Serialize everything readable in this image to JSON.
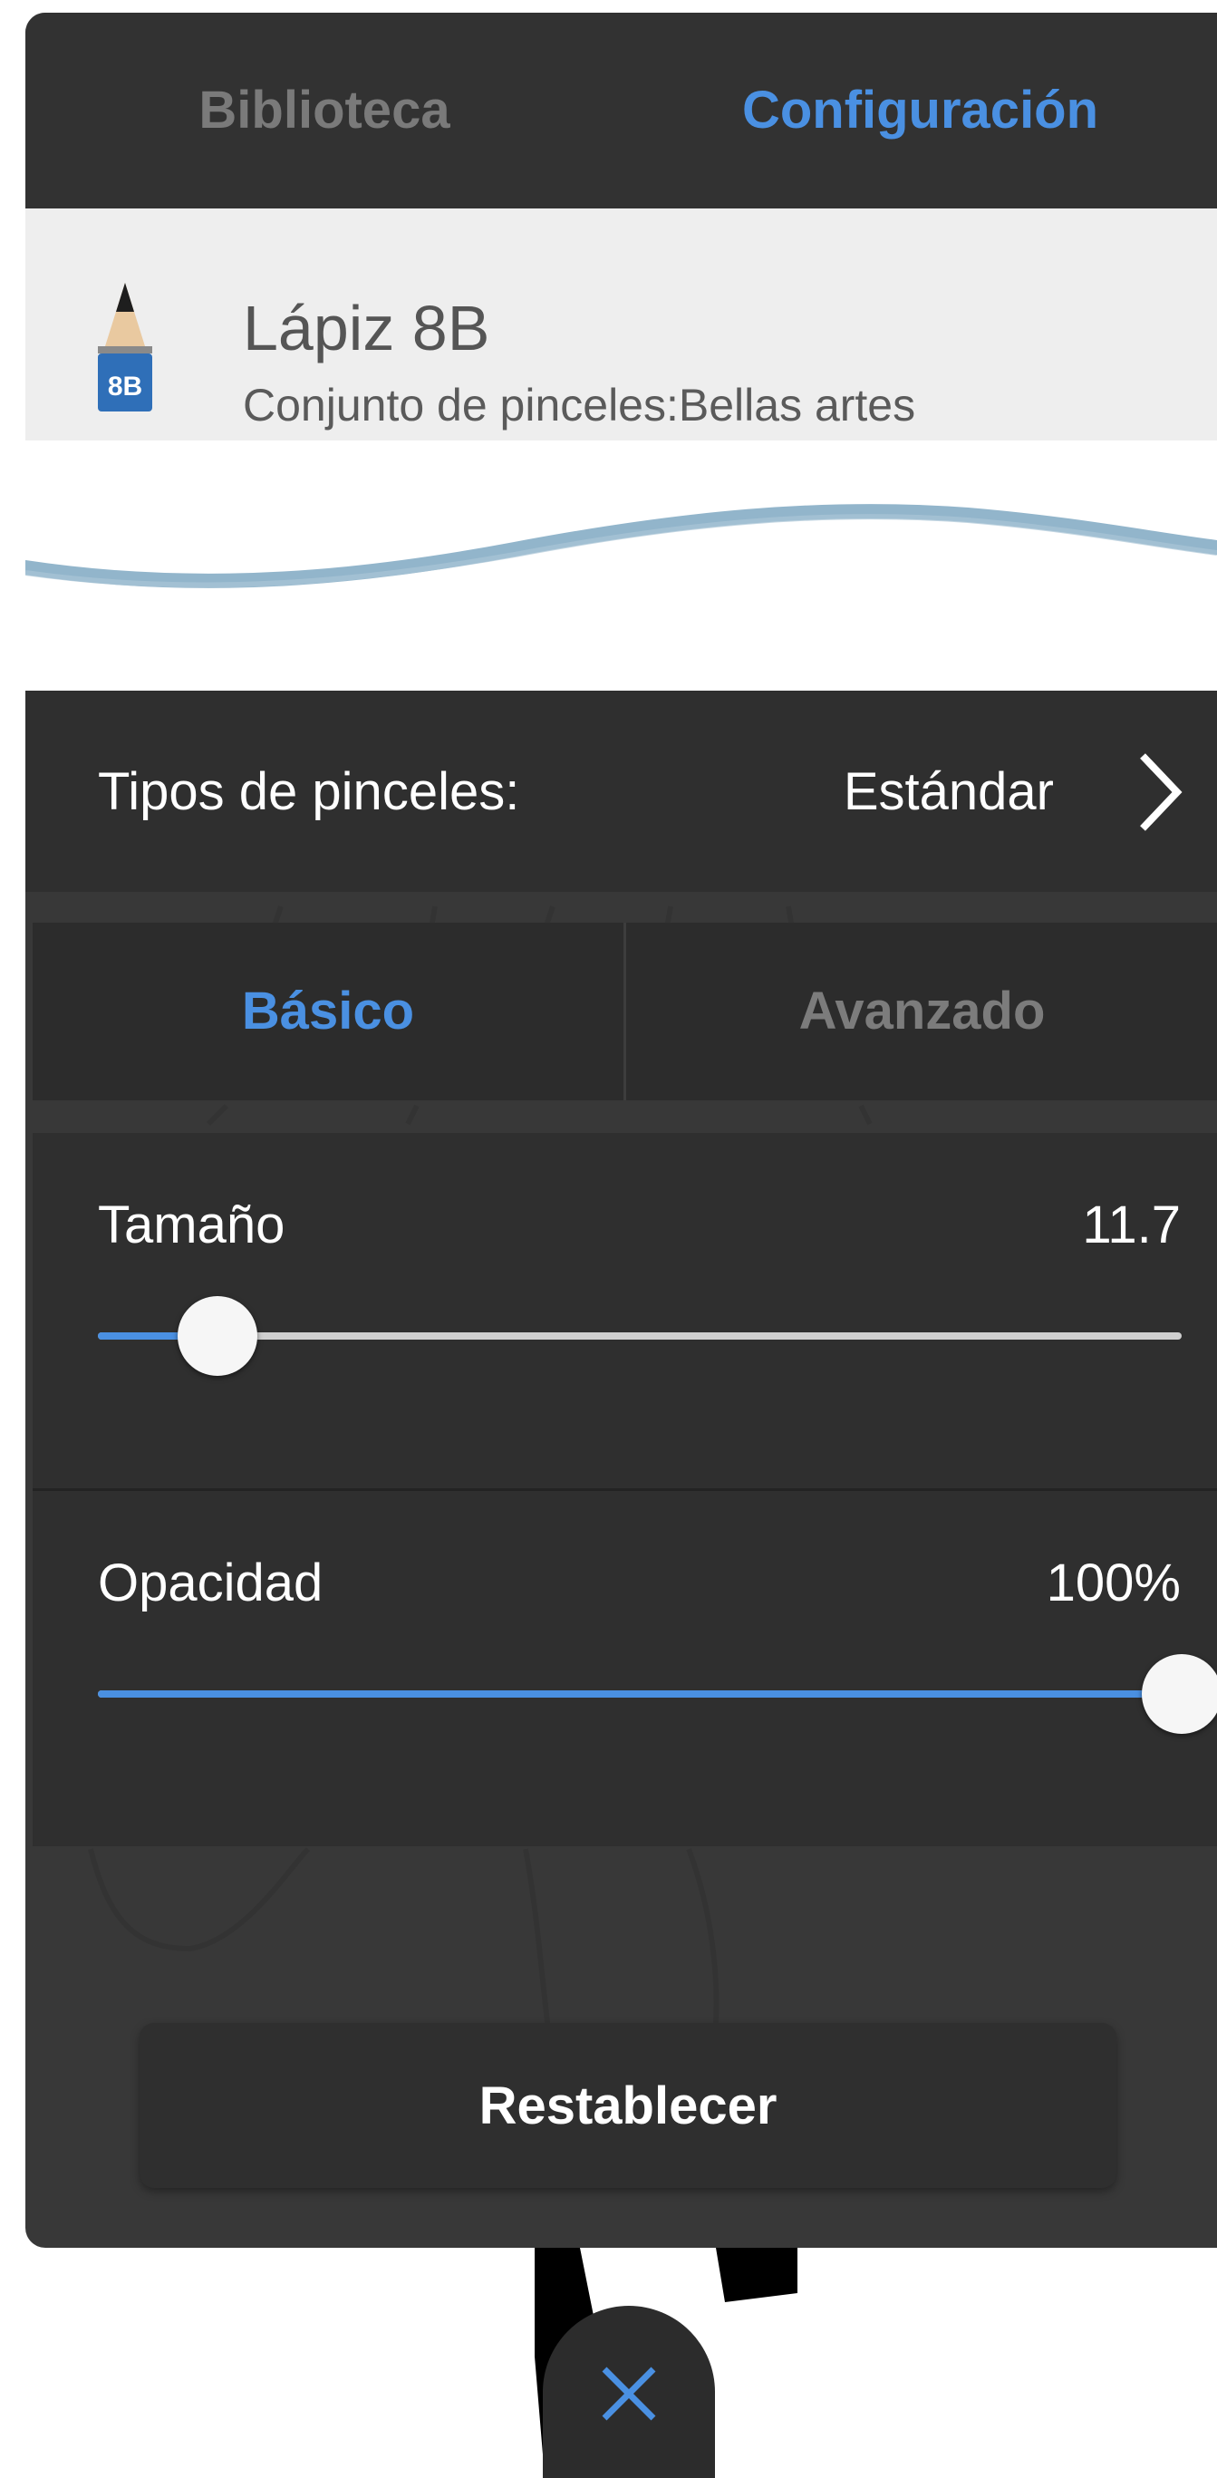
{
  "tabs": {
    "library": "Biblioteca",
    "settings": "Configuración",
    "active": "settings"
  },
  "brush": {
    "name": "Lápiz 8B",
    "set": "Conjunto de pinceles:Bellas artes",
    "icon_label": "8B"
  },
  "brush_type": {
    "label": "Tipos de pinceles:",
    "value": "Estándar"
  },
  "mode_tabs": {
    "basic": "Básico",
    "advanced": "Avanzado",
    "active": "basic"
  },
  "size": {
    "label": "Tamaño",
    "value": "11.7",
    "fraction": 0.11
  },
  "opacity": {
    "label": "Opacidad",
    "value": "100%",
    "fraction": 1.0
  },
  "reset_label": "Restablecer",
  "colors": {
    "accent": "#4a90e2",
    "panel": "#2f2f2f",
    "inactive_text": "#7a7a7a"
  }
}
